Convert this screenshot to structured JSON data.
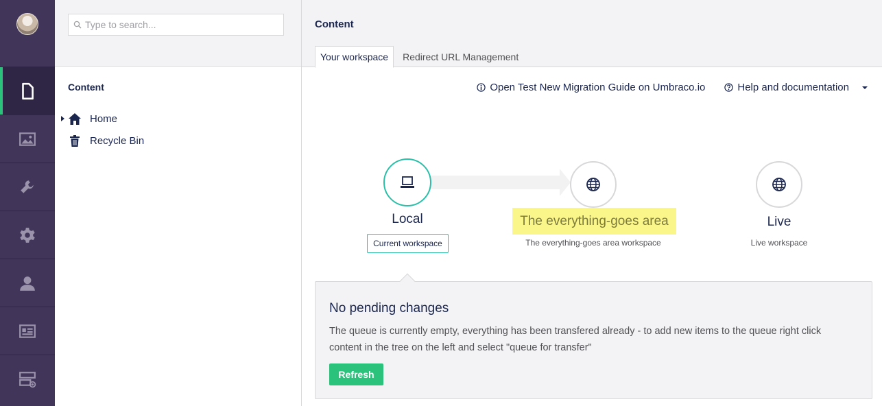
{
  "search": {
    "placeholder": "Type to search..."
  },
  "sections": [
    {
      "icon": "document-icon",
      "active": true
    },
    {
      "icon": "image-icon",
      "active": false
    },
    {
      "icon": "wrench-icon",
      "active": false
    },
    {
      "icon": "gear-icon",
      "active": false
    },
    {
      "icon": "user-icon",
      "active": false
    },
    {
      "icon": "id-card-icon",
      "active": false
    },
    {
      "icon": "form-icon",
      "active": false
    }
  ],
  "tree": {
    "heading": "Content",
    "nodes": [
      {
        "label": "Home",
        "icon": "home-icon",
        "has_children": true
      },
      {
        "label": "Recycle Bin",
        "icon": "trash-icon",
        "has_children": false
      }
    ]
  },
  "main": {
    "title": "Content",
    "tabs": [
      {
        "label": "Your workspace",
        "active": true
      },
      {
        "label": "Redirect URL Management",
        "active": false
      }
    ],
    "help": {
      "migration_link": "Open Test New Migration Guide on Umbraco.io",
      "docs_link": "Help and documentation"
    }
  },
  "workflow": {
    "local": {
      "title": "Local",
      "badge": "Current workspace",
      "icon": "laptop-icon"
    },
    "env": {
      "title": "The everything-goes area",
      "subtitle": "The everything-goes area workspace",
      "icon": "globe-icon"
    },
    "live": {
      "title": "Live",
      "subtitle": "Live workspace",
      "icon": "globe-icon"
    }
  },
  "pending": {
    "title": "No pending changes",
    "body": "The queue is currently empty, everything has been transfered already - to add new items to the queue right click content in the tree on the left and select \"queue for transfer\"",
    "refresh_label": "Refresh"
  },
  "colors": {
    "appbar": "#413659",
    "accent_green": "#2bc37c",
    "accent_teal": "#2bbfa8",
    "highlight": "#fbf68a"
  }
}
